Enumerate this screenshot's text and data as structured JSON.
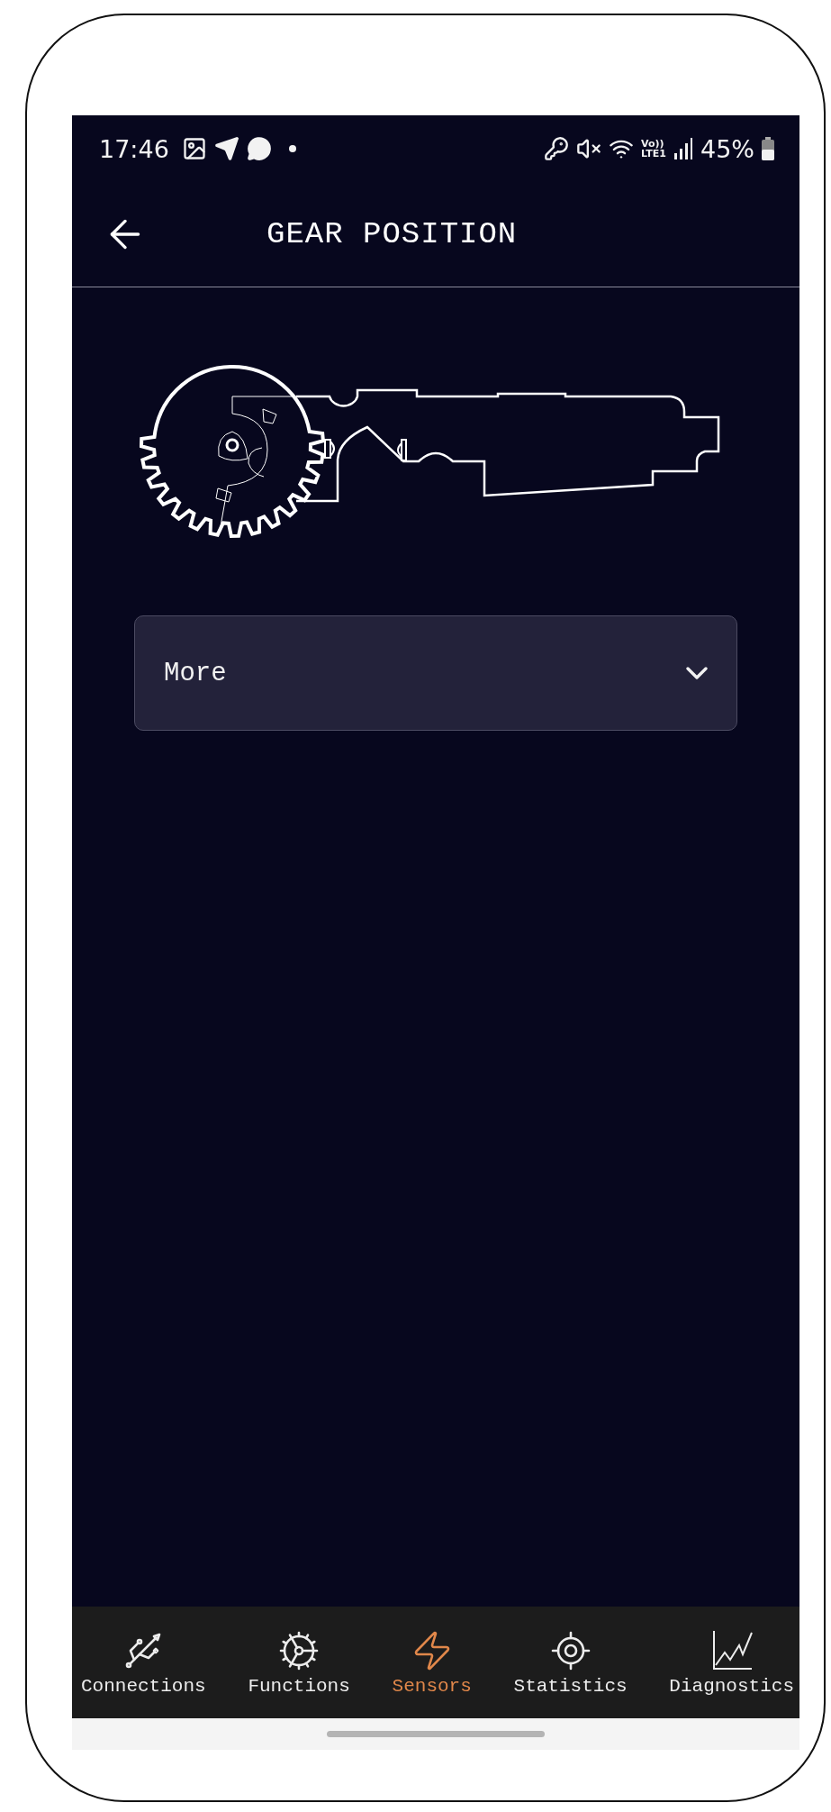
{
  "status_bar": {
    "time": "17:46",
    "volte": [
      "Vo))",
      "LTE1"
    ],
    "battery": "45%"
  },
  "header": {
    "title": "GEAR POSITION"
  },
  "dropdown": {
    "label": "More",
    "expanded": false
  },
  "nav": [
    {
      "label": "Connections",
      "kind": "usb",
      "selected": false
    },
    {
      "label": "Functions",
      "kind": "gear",
      "selected": false
    },
    {
      "label": "Sensors",
      "kind": "bolt",
      "selected": true
    },
    {
      "label": "Statistics",
      "kind": "target",
      "selected": false
    },
    {
      "label": "Diagnostics",
      "kind": "chart",
      "selected": false
    }
  ]
}
